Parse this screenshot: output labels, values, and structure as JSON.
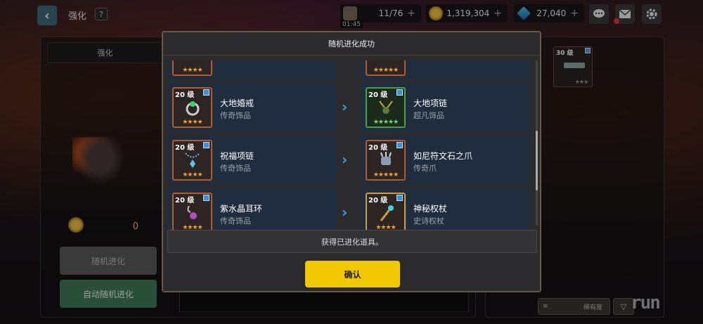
{
  "header": {
    "title": "强化",
    "help_label": "?",
    "back_label": "‹",
    "stamina": "11/76",
    "stamina_timer": "01:45",
    "gold": "1,319,304",
    "gems": "27,040",
    "plus_label": "+"
  },
  "left": {
    "tab_label": "强化",
    "cost": "0",
    "random_button": "随机进化",
    "auto_button": "自动随机进化"
  },
  "right": {
    "item_level": "30 级",
    "item_stars": "★★★",
    "sort_label": "稀有度",
    "sort_icon": "≡",
    "filter_icon": "▽"
  },
  "modal": {
    "title": "随机进化成功",
    "info_text": "获得已进化道具。",
    "confirm_label": "确认",
    "rows": [
      {
        "left": {
          "level": "20 级",
          "name": "大地婚戒",
          "type": "传奇饰品",
          "stars": "★★★★",
          "rarity": "orange"
        },
        "right": {
          "level": "20 级",
          "name": "大地项链",
          "type": "超凡饰品",
          "stars": "★★★★★",
          "rarity": "green"
        }
      },
      {
        "left": {
          "level": "20 级",
          "name": "祝福项链",
          "type": "传奇饰品",
          "stars": "★★★★",
          "rarity": "orange"
        },
        "right": {
          "level": "20 级",
          "name": "如尼符文石之爪",
          "type": "传奇爪",
          "stars": "★★★★★",
          "rarity": "orange"
        }
      },
      {
        "left": {
          "level": "20 级",
          "name": "紫水晶耳环",
          "type": "传奇饰品",
          "stars": "★★★★",
          "rarity": "orange"
        },
        "right": {
          "level": "20 级",
          "name": "神秘权杖",
          "type": "史诗权杖",
          "stars": "★★★★",
          "rarity": "orange"
        }
      }
    ],
    "partial_top": {
      "left_stars": "★★★★",
      "right_stars": "★★★★★"
    }
  },
  "watermark": "run",
  "colors": {
    "confirm": "#f2c800",
    "auto_button": "#3f7a58",
    "arrow": "#3a9ee8",
    "legendary_border": "#b45a2e",
    "transcendent_border": "#4aa04a"
  }
}
